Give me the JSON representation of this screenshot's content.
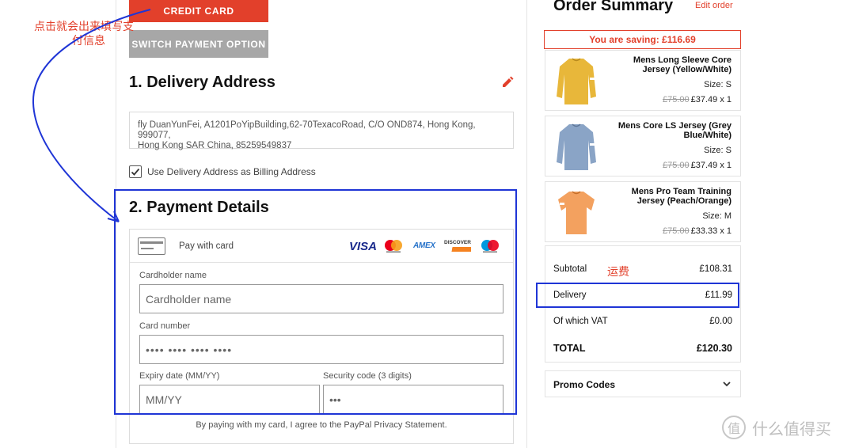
{
  "buttons": {
    "credit_card": "CREDIT CARD",
    "switch_payment": "SWITCH PAYMENT OPTION"
  },
  "delivery": {
    "heading": "1. Delivery Address",
    "address_line1": "fly DuanYunFei, A1201PoYipBuilding,62-70TexacoRoad, C/O OND874, Hong Kong, 999077,",
    "address_line2": "Hong Kong SAR China, 85259549837",
    "billing_label": "Use Delivery Address as Billing Address",
    "billing_checked": true
  },
  "payment": {
    "heading": "2. Payment Details",
    "pay_with_card": "Pay with card",
    "brands": [
      "visa",
      "mastercard",
      "amex",
      "discover",
      "maestro"
    ],
    "visa_text": "VISA",
    "amex_text": "AMEX",
    "discover_text": "DISCOVER",
    "cardholder_label": "Cardholder name",
    "cardholder_placeholder": "Cardholder name",
    "card_number_label": "Card number",
    "card_number_placeholder": "•••• •••• •••• ••••",
    "expiry_label": "Expiry date  (MM/YY)",
    "expiry_placeholder": "MM/YY",
    "security_label": "Security code  (3 digits)",
    "security_placeholder": "•••",
    "agree_text": "By paying with my card, I agree to the PayPal Privacy Statement."
  },
  "summary": {
    "title": "Order Summary",
    "edit_order": "Edit order",
    "saving": "You are saving: £116.69",
    "items": [
      {
        "name": "Mens Long Sleeve Core Jersey (Yellow/White)",
        "size": "Size: S",
        "old_price": "£75.00",
        "price": "£37.49 x 1",
        "color": "#e8b73a"
      },
      {
        "name": "Mens Core LS Jersey (Grey Blue/White)",
        "size": "Size: S",
        "old_price": "£75.00",
        "price": "£37.49 x 1",
        "color": "#8aa4c6"
      },
      {
        "name": "Mens Pro Team Training Jersey (Peach/Orange)",
        "size": "Size: M",
        "old_price": "£75.00",
        "price": "£33.33 x 1",
        "color": "#f3a15f"
      }
    ],
    "subtotal_label": "Subtotal",
    "subtotal_value": "£108.31",
    "delivery_label": "Delivery",
    "delivery_value": "£11.99",
    "vat_label": "Of which VAT",
    "vat_value": "£0.00",
    "total_label": "TOTAL",
    "total_value": "£120.30",
    "promo_label": "Promo Codes"
  },
  "annotations": {
    "arrow_note_line1": "点击就会出来填写支",
    "arrow_note_line2": "付信息",
    "shipping_note": "运费",
    "accent_red": "#e2402b",
    "highlight_blue": "#1f35d6"
  },
  "watermark": {
    "logo_glyph": "值",
    "text": "什么值得买"
  }
}
